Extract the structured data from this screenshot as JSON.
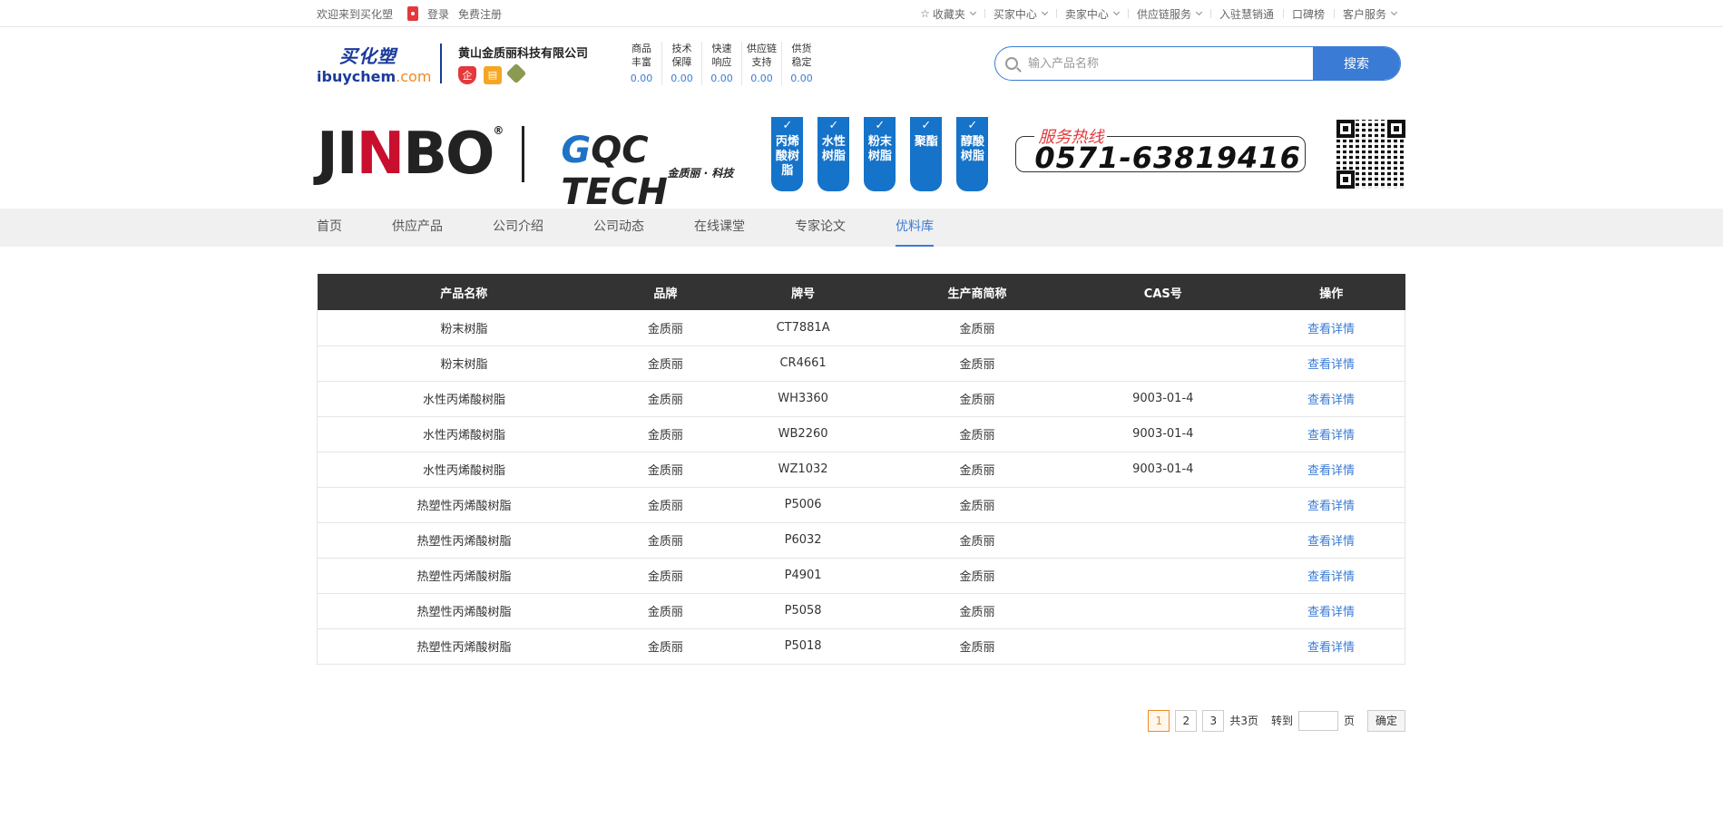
{
  "topbar": {
    "welcome": "欢迎来到买化塑",
    "login": "登录",
    "register": "免费注册",
    "favorites": "收藏夹",
    "buyer_center": "买家中心",
    "seller_center": "卖家中心",
    "supply_chain": "供应链服务",
    "join": "入驻慧销通",
    "ranking": "口碑榜",
    "customer_service": "客户服务"
  },
  "header": {
    "logo_cn": "买化塑",
    "logo_en_a": "ibuychem",
    "logo_en_b": ".com",
    "company_name": "黄山金质丽科技有限公司",
    "badge_enterprise": "企",
    "stats": [
      {
        "l1": "商品",
        "l2": "丰富",
        "value": "0.00"
      },
      {
        "l1": "技术",
        "l2": "保障",
        "value": "0.00"
      },
      {
        "l1": "快速",
        "l2": "响应",
        "value": "0.00"
      },
      {
        "l1": "供应链",
        "l2": "支持",
        "value": "0.00"
      },
      {
        "l1": "供货",
        "l2": "稳定",
        "value": "0.00"
      }
    ],
    "search_placeholder": "输入产品名称",
    "search_button": "搜索"
  },
  "banner": {
    "brand_a": "JI",
    "brand_n": "N",
    "brand_b": "BO",
    "brand_reg": "®",
    "qc_g": "G",
    "qc_rest": "QC TECH",
    "qc_sub": "金质丽 · 科技",
    "tags": [
      {
        "l1": "丙烯",
        "l2": "酸树",
        "l3": "脂"
      },
      {
        "l1": "水性",
        "l2": "树脂",
        "l3": ""
      },
      {
        "l1": "粉末",
        "l2": "树脂",
        "l3": ""
      },
      {
        "l1": "聚酯",
        "l2": "",
        "l3": ""
      },
      {
        "l1": "醇酸",
        "l2": "树脂",
        "l3": ""
      }
    ],
    "hotline_title": "服务热线",
    "hotline_number": "0571-63819416"
  },
  "nav": {
    "items": [
      "首页",
      "供应产品",
      "公司介绍",
      "公司动态",
      "在线课堂",
      "专家论文",
      "优料库"
    ],
    "active_index": 6
  },
  "table": {
    "headers": [
      "产品名称",
      "品牌",
      "牌号",
      "生产商简称",
      "CAS号",
      "操作"
    ],
    "rows": [
      [
        "粉末树脂",
        "金质丽",
        "CT7881A",
        "金质丽",
        "",
        "查看详情"
      ],
      [
        "粉末树脂",
        "金质丽",
        "CR4661",
        "金质丽",
        "",
        "查看详情"
      ],
      [
        "水性丙烯酸树脂",
        "金质丽",
        "WH3360",
        "金质丽",
        "9003-01-4",
        "查看详情"
      ],
      [
        "水性丙烯酸树脂",
        "金质丽",
        "WB2260",
        "金质丽",
        "9003-01-4",
        "查看详情"
      ],
      [
        "水性丙烯酸树脂",
        "金质丽",
        "WZ1032",
        "金质丽",
        "9003-01-4",
        "查看详情"
      ],
      [
        "热塑性丙烯酸树脂",
        "金质丽",
        "P5006",
        "金质丽",
        "",
        "查看详情"
      ],
      [
        "热塑性丙烯酸树脂",
        "金质丽",
        "P6032",
        "金质丽",
        "",
        "查看详情"
      ],
      [
        "热塑性丙烯酸树脂",
        "金质丽",
        "P4901",
        "金质丽",
        "",
        "查看详情"
      ],
      [
        "热塑性丙烯酸树脂",
        "金质丽",
        "P5058",
        "金质丽",
        "",
        "查看详情"
      ],
      [
        "热塑性丙烯酸树脂",
        "金质丽",
        "P5018",
        "金质丽",
        "",
        "查看详情"
      ]
    ]
  },
  "pager": {
    "pages": [
      "1",
      "2",
      "3"
    ],
    "current": "1",
    "total": "共3页",
    "goto": "转到",
    "page_unit": "页",
    "confirm": "确定"
  },
  "colors": {
    "accent": "#3a7bd5",
    "table_header": "#333333",
    "tag_blue": "#1573c9",
    "current_page": "#f08a24"
  }
}
